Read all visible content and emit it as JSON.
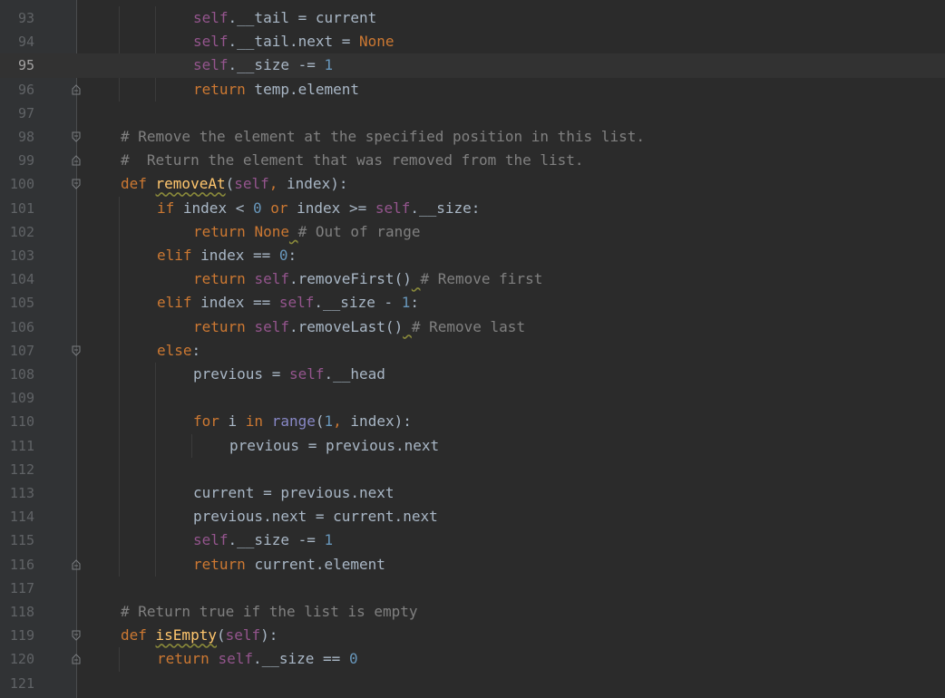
{
  "editor": {
    "current_line": 95,
    "lines": [
      {
        "num": "93",
        "indent": 2,
        "fold": "none",
        "tokens": [
          [
            "self",
            "self"
          ],
          [
            "id",
            ".__tail = current"
          ]
        ]
      },
      {
        "num": "94",
        "indent": 2,
        "fold": "none",
        "tokens": [
          [
            "self",
            "self"
          ],
          [
            "id",
            ".__tail.next = "
          ],
          [
            "kw",
            "None"
          ]
        ]
      },
      {
        "num": "95",
        "indent": 2,
        "fold": "none",
        "tokens": [
          [
            "self",
            "self"
          ],
          [
            "id",
            ".__size -= "
          ],
          [
            "num",
            "1"
          ]
        ]
      },
      {
        "num": "96",
        "indent": 2,
        "fold": "end",
        "tokens": [
          [
            "kw",
            "return"
          ],
          [
            "id",
            " temp.element"
          ]
        ]
      },
      {
        "num": "97",
        "indent": 0,
        "fold": "none",
        "tokens": []
      },
      {
        "num": "98",
        "indent": 0,
        "fold": "start",
        "tokens": [
          [
            "cmt",
            "# Remove the element at the specified position in this list."
          ]
        ]
      },
      {
        "num": "99",
        "indent": 0,
        "fold": "end",
        "tokens": [
          [
            "cmt",
            "#  Return the element that was removed from the list."
          ]
        ]
      },
      {
        "num": "100",
        "indent": 0,
        "fold": "start",
        "tokens": [
          [
            "kw",
            "def "
          ],
          [
            "fn",
            "removeAt"
          ],
          [
            "id",
            "("
          ],
          [
            "self",
            "self"
          ],
          [
            "kw",
            ", "
          ],
          [
            "id",
            "index):"
          ]
        ]
      },
      {
        "num": "101",
        "indent": 1,
        "fold": "none",
        "tokens": [
          [
            "kw",
            "if "
          ],
          [
            "id",
            "index < "
          ],
          [
            "num",
            "0"
          ],
          [
            "kw",
            " or "
          ],
          [
            "id",
            "index >= "
          ],
          [
            "self",
            "self"
          ],
          [
            "id",
            ".__size:"
          ]
        ]
      },
      {
        "num": "102",
        "indent": 2,
        "fold": "none",
        "tokens": [
          [
            "kw",
            "return "
          ],
          [
            "kw",
            "None"
          ],
          [
            "ws",
            " "
          ],
          [
            "cmt",
            "# Out of range"
          ]
        ]
      },
      {
        "num": "103",
        "indent": 1,
        "fold": "none",
        "tokens": [
          [
            "kw",
            "elif "
          ],
          [
            "id",
            "index == "
          ],
          [
            "num",
            "0"
          ],
          [
            "id",
            ":"
          ]
        ]
      },
      {
        "num": "104",
        "indent": 2,
        "fold": "none",
        "tokens": [
          [
            "kw",
            "return "
          ],
          [
            "self",
            "self"
          ],
          [
            "id",
            ".removeFirst()"
          ],
          [
            "ws",
            " "
          ],
          [
            "cmt",
            "# Remove first"
          ]
        ]
      },
      {
        "num": "105",
        "indent": 1,
        "fold": "none",
        "tokens": [
          [
            "kw",
            "elif "
          ],
          [
            "id",
            "index == "
          ],
          [
            "self",
            "self"
          ],
          [
            "id",
            ".__size - "
          ],
          [
            "num",
            "1"
          ],
          [
            "id",
            ":"
          ]
        ]
      },
      {
        "num": "106",
        "indent": 2,
        "fold": "none",
        "tokens": [
          [
            "kw",
            "return "
          ],
          [
            "self",
            "self"
          ],
          [
            "id",
            ".removeLast()"
          ],
          [
            "ws",
            " "
          ],
          [
            "cmt",
            "# Remove last"
          ]
        ]
      },
      {
        "num": "107",
        "indent": 1,
        "fold": "start",
        "tokens": [
          [
            "kw",
            "else"
          ],
          [
            "id",
            ":"
          ]
        ]
      },
      {
        "num": "108",
        "indent": 2,
        "fold": "none",
        "tokens": [
          [
            "id",
            "previous = "
          ],
          [
            "self",
            "self"
          ],
          [
            "id",
            ".__head"
          ]
        ]
      },
      {
        "num": "109",
        "indent": 0,
        "fold": "none",
        "tokens": []
      },
      {
        "num": "110",
        "indent": 2,
        "fold": "none",
        "tokens": [
          [
            "kw",
            "for "
          ],
          [
            "id",
            "i "
          ],
          [
            "kw",
            "in "
          ],
          [
            "bi",
            "range"
          ],
          [
            "id",
            "("
          ],
          [
            "num",
            "1"
          ],
          [
            "kw",
            ", "
          ],
          [
            "id",
            "index):"
          ]
        ]
      },
      {
        "num": "111",
        "indent": 3,
        "fold": "none",
        "tokens": [
          [
            "id",
            "previous = previous.next"
          ]
        ]
      },
      {
        "num": "112",
        "indent": 0,
        "fold": "none",
        "tokens": []
      },
      {
        "num": "113",
        "indent": 2,
        "fold": "none",
        "tokens": [
          [
            "id",
            "current = previous.next"
          ]
        ]
      },
      {
        "num": "114",
        "indent": 2,
        "fold": "none",
        "tokens": [
          [
            "id",
            "previous.next = current.next"
          ]
        ]
      },
      {
        "num": "115",
        "indent": 2,
        "fold": "none",
        "tokens": [
          [
            "self",
            "self"
          ],
          [
            "id",
            ".__size -= "
          ],
          [
            "num",
            "1"
          ]
        ]
      },
      {
        "num": "116",
        "indent": 2,
        "fold": "end",
        "tokens": [
          [
            "kw",
            "return "
          ],
          [
            "id",
            "current.element"
          ]
        ]
      },
      {
        "num": "117",
        "indent": 0,
        "fold": "none",
        "tokens": []
      },
      {
        "num": "118",
        "indent": 0,
        "fold": "none",
        "tokens": [
          [
            "cmt",
            "# Return true if the list is empty"
          ]
        ]
      },
      {
        "num": "119",
        "indent": 0,
        "fold": "start",
        "tokens": [
          [
            "kw",
            "def "
          ],
          [
            "fn",
            "isEmpty"
          ],
          [
            "id",
            "("
          ],
          [
            "self",
            "self"
          ],
          [
            "id",
            "):"
          ]
        ]
      },
      {
        "num": "120",
        "indent": 1,
        "fold": "end",
        "tokens": [
          [
            "kw",
            "return "
          ],
          [
            "self",
            "self"
          ],
          [
            "id",
            ".__size == "
          ],
          [
            "num",
            "0"
          ]
        ]
      },
      {
        "num": "121",
        "indent": 0,
        "fold": "none",
        "tokens": []
      }
    ]
  }
}
